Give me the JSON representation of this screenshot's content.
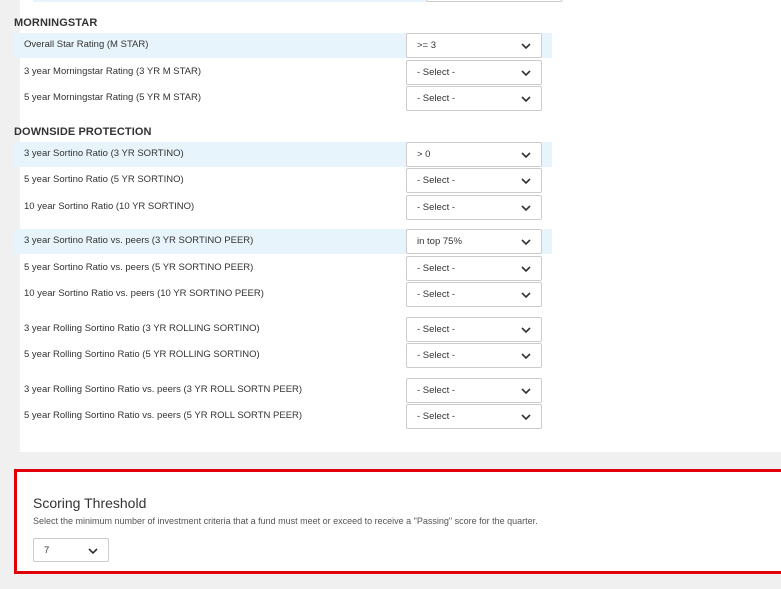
{
  "morningstar": {
    "heading": "MORNINGSTAR",
    "rows": [
      {
        "label": "Overall Star Rating (M STAR)",
        "value": ">= 3"
      },
      {
        "label": "3 year Morningstar Rating (3 YR M STAR)",
        "value": "- Select -"
      },
      {
        "label": "5 year Morningstar Rating (5 YR M STAR)",
        "value": "- Select -"
      }
    ]
  },
  "downside": {
    "heading": "DOWNSIDE PROTECTION",
    "rows": [
      {
        "label": "3 year Sortino Ratio (3 YR SORTINO)",
        "value": "> 0"
      },
      {
        "label": "5 year Sortino Ratio (5 YR SORTINO)",
        "value": "- Select -"
      },
      {
        "label": "10 year Sortino Ratio (10 YR SORTINO)",
        "value": "- Select -"
      },
      {
        "label": "3 year Sortino Ratio vs. peers (3 YR SORTINO PEER)",
        "value": "in top 75%"
      },
      {
        "label": "5 year Sortino Ratio vs. peers (5 YR SORTINO PEER)",
        "value": "- Select -"
      },
      {
        "label": "10 year Sortino Ratio vs. peers (10 YR SORTINO PEER)",
        "value": "- Select -"
      },
      {
        "label": "3 year Rolling Sortino Ratio (3 YR ROLLING SORTINO)",
        "value": "- Select -"
      },
      {
        "label": "5 year Rolling Sortino Ratio (5 YR ROLLING SORTINO)",
        "value": "- Select -"
      },
      {
        "label": "3 year Rolling Sortino Ratio vs. peers (3 YR ROLL SORTN PEER)",
        "value": "- Select -"
      },
      {
        "label": "5 year Rolling Sortino Ratio vs. peers (5 YR ROLL SORTN PEER)",
        "value": "- Select -"
      }
    ]
  },
  "scoring": {
    "title": "Scoring Threshold",
    "description": "Select the minimum number of investment criteria that a fund must meet or exceed to receive a \"Passing\" score for the quarter.",
    "value": "7"
  },
  "colors": {
    "highlight_row": "#e8f4fb",
    "alert_border": "#e0000a"
  },
  "icons": {
    "dropdown": "chevron-down-icon"
  }
}
